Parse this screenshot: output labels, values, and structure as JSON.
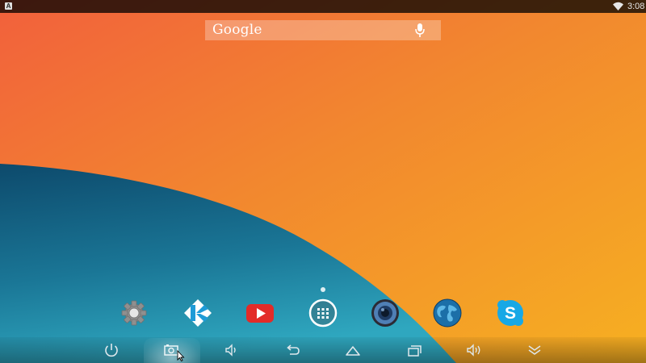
{
  "wallpaper": {
    "colors": {
      "orange_top": "#f26a3c",
      "orange_mid": "#f28c2f",
      "orange_right": "#f6a427",
      "teal_dark": "#0f5071",
      "teal_light": "#2aa1bd"
    }
  },
  "status_bar": {
    "notification_icon": "notification-a-icon",
    "notification_glyph": "A",
    "wifi_icon": "wifi-icon",
    "time": "3:08"
  },
  "search": {
    "logo": "Google",
    "mic_icon": "mic-icon"
  },
  "home": {
    "page_indicator_icon": "page-dot-icon"
  },
  "dock": {
    "apps": [
      {
        "icon": "settings-gear-icon",
        "color": "#8d8d8d"
      },
      {
        "icon": "kodi-icon",
        "color": "#1e9bd7"
      },
      {
        "icon": "youtube-icon",
        "color": "#e32b28"
      },
      {
        "icon": "app-drawer-icon",
        "color": "#ffffff"
      },
      {
        "icon": "speaker-music-icon",
        "color": "#3b6ea8"
      },
      {
        "icon": "globe-browser-icon",
        "color": "#1f79b5"
      },
      {
        "icon": "skype-icon",
        "color": "#17a8e6"
      }
    ]
  },
  "nav_bar": {
    "buttons": [
      {
        "icon": "power-icon"
      },
      {
        "icon": "screenshot-icon",
        "highlighted": true
      },
      {
        "icon": "volume-down-icon"
      },
      {
        "icon": "back-icon"
      },
      {
        "icon": "home-icon"
      },
      {
        "icon": "recent-apps-icon"
      },
      {
        "icon": "volume-up-icon"
      },
      {
        "icon": "hide-bar-icon"
      }
    ],
    "cursor_icon": "mouse-cursor-icon"
  }
}
